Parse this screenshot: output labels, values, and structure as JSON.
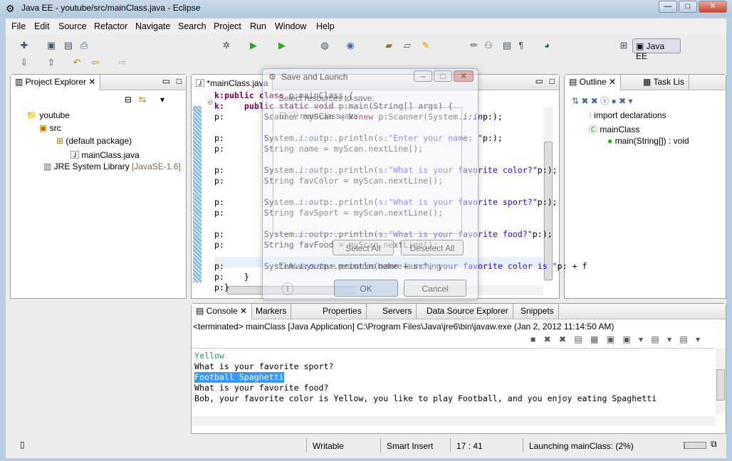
{
  "window": {
    "title": "Java EE - youtube/src/mainClass.java - Eclipse",
    "min": "—",
    "max": "□",
    "close": "✕"
  },
  "menu": [
    "File",
    "Edit",
    "Source",
    "Refactor",
    "Navigate",
    "Search",
    "Project",
    "Run",
    "Window",
    "Help"
  ],
  "perspective": "Java EE",
  "project_explorer": {
    "title": "Project Explorer",
    "items": [
      "youtube",
      "src",
      "(default package)",
      "mainClass.java",
      "JRE System Library"
    ],
    "jre_suffix": "[JavaSE-1.6]"
  },
  "editor": {
    "tab": "*mainClass.java",
    "lines": [
      [
        "k:public class ",
        "p:mainClass {"
      ],
      [
        "k:    public static void ",
        "p:main(String[] args) {"
      ],
      [
        "p:        Scanner myScan = ",
        "k:new ",
        "p:Scanner(System.",
        "i:in",
        "p:);"
      ],
      [],
      [
        "p:        System.",
        "i:out",
        "p:.println(",
        "s:\"Enter your name: \"",
        "p:);"
      ],
      [
        "p:        String name = myScan.nextLine();"
      ],
      [],
      [
        "p:        System.",
        "i:out",
        "p:.println(",
        "s:\"What is your favorite color?\"",
        "p:);"
      ],
      [
        "p:        String favColor = myScan.nextLine();"
      ],
      [],
      [
        "p:        System.",
        "i:out",
        "p:.println(",
        "s:\"What is your favorite sport?\"",
        "p:);"
      ],
      [
        "p:        String favSport = myScan.nextLine();"
      ],
      [],
      [
        "p:        System.",
        "i:out",
        "p:.println(",
        "s:\"What is your favorite food?\"",
        "p:);"
      ],
      [
        "p:        String favFood = myScan.nextLine();"
      ],
      [],
      [
        "p:        System.",
        "i:out",
        "p:.println(name + ",
        "s:\", your favorite color is \"",
        "p: + f"
      ],
      [
        "p:    }"
      ],
      [
        "p:}"
      ]
    ]
  },
  "outline": {
    "title": "Outline",
    "task_tab": "Task Lis",
    "items": [
      "import declarations",
      "mainClass",
      "main(String[]) : void"
    ]
  },
  "dialog": {
    "title": "Save and Launch",
    "prompt": "Select resources to save:",
    "resource": "mainClass.java",
    "select_all": "Select All",
    "deselect_all": "Deselect All",
    "always_save": "Always save resources before launching",
    "ok": "OK",
    "cancel": "Cancel"
  },
  "console": {
    "tabs": [
      "Console",
      "Markers",
      "Properties",
      "Servers",
      "Data Source Explorer",
      "Snippets"
    ],
    "header": "<terminated> mainClass [Java Application] C:\\Program Files\\Java\\jre6\\bin\\javaw.exe (Jan 2, 2012 11:14:50 AM)",
    "lines": [
      "Yellow",
      "What is your favorite sport?",
      "Football Spaghetti",
      "What is your favorite food?",
      "Bob, your favorite color is Yellow, you like to play Football, and you enjoy eating Spaghetti"
    ]
  },
  "status": {
    "writable": "Writable",
    "insert": "Smart Insert",
    "position": "17 : 41",
    "progress_text": "Launching mainClass: (2%)",
    "progress": 0.02
  }
}
